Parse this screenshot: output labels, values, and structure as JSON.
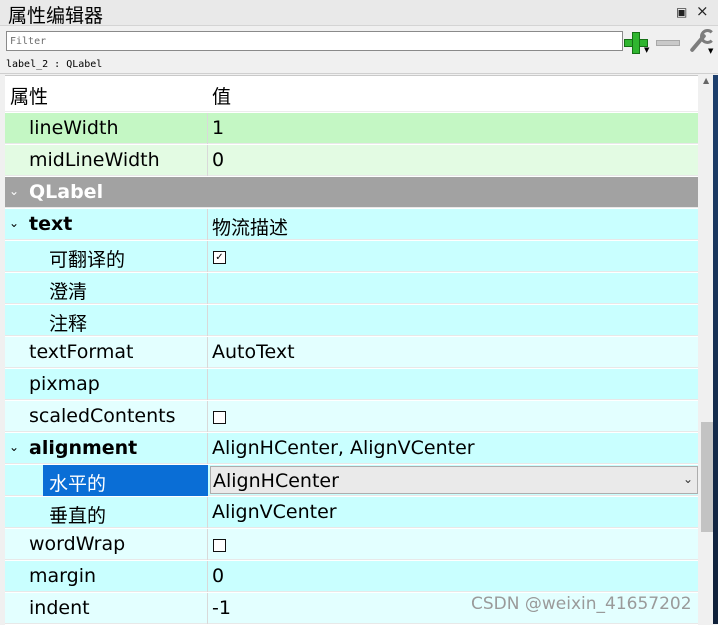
{
  "window": {
    "title": "属性编辑器"
  },
  "toolbar": {
    "filter_placeholder": "Filter"
  },
  "object": {
    "label": "label_2 : QLabel"
  },
  "table": {
    "col_name": "属性",
    "col_value": "值"
  },
  "rows": [
    {
      "name": "lineWidth",
      "value": "1"
    },
    {
      "name": "midLineWidth",
      "value": "0"
    },
    {
      "name": "QLabel",
      "value": ""
    },
    {
      "name": "text",
      "value": "物流描述"
    },
    {
      "name": "可翻译的",
      "value": ""
    },
    {
      "name": "澄清",
      "value": ""
    },
    {
      "name": "注释",
      "value": ""
    },
    {
      "name": "textFormat",
      "value": "AutoText"
    },
    {
      "name": "pixmap",
      "value": ""
    },
    {
      "name": "scaledContents",
      "value": ""
    },
    {
      "name": "alignment",
      "value": "AlignHCenter, AlignVCenter"
    },
    {
      "name": "水平的",
      "value": "AlignHCenter"
    },
    {
      "name": "垂直的",
      "value": "AlignVCenter"
    },
    {
      "name": "wordWrap",
      "value": ""
    },
    {
      "name": "margin",
      "value": "0"
    },
    {
      "name": "indent",
      "value": "-1"
    }
  ],
  "watermark": "CSDN @weixin_41657202",
  "colors": {
    "group_qframe": "#c4f7c4",
    "group_qlabel": "#c9ffff",
    "section": "#a2a2a2",
    "selection": "#0a6ed6"
  },
  "icons": {
    "add": "add-property-icon",
    "remove": "remove-property-icon",
    "configure": "wrench-icon"
  }
}
